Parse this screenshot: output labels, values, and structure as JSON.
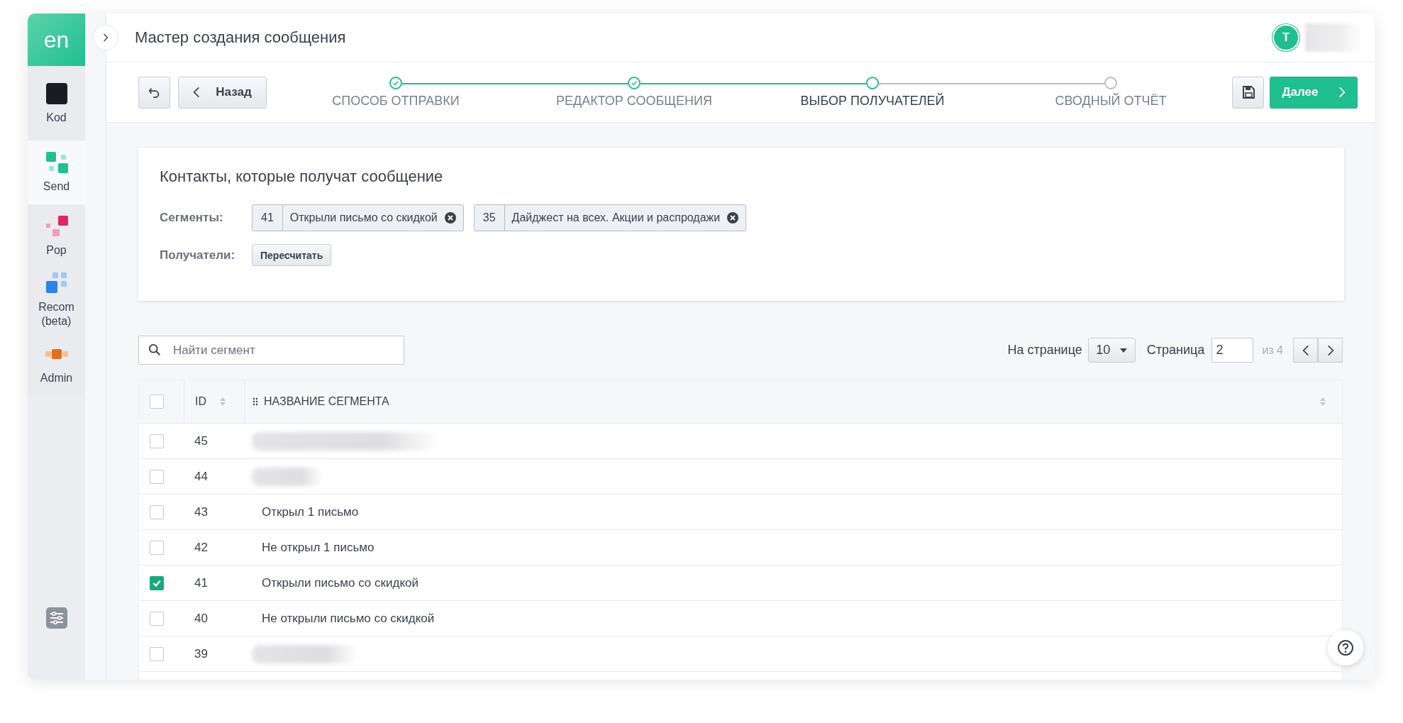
{
  "logo": "en",
  "sidebar": {
    "items": [
      {
        "label": "Kod",
        "kind": "kod",
        "selected": false
      },
      {
        "label": "Send",
        "kind": "send",
        "selected": true
      },
      {
        "label": "Pop",
        "kind": "pop",
        "selected": false
      },
      {
        "label": "Recom (beta)",
        "kind": "recom",
        "selected": false
      },
      {
        "label": "Admin",
        "kind": "admin",
        "selected": false
      }
    ]
  },
  "header": {
    "title": "Мастер создания сообщения",
    "user_initial": "T"
  },
  "toolbar": {
    "back_button": "Назад",
    "next_button": "Далее"
  },
  "steps": [
    {
      "label": "СПОСОБ ОТПРАВКИ",
      "done": true,
      "selected": false
    },
    {
      "label": "РЕДАКТОР СООБЩЕНИЯ",
      "done": true,
      "selected": false
    },
    {
      "label": "ВЫБОР ПОЛУЧАТЕЛЕЙ",
      "done": false,
      "selected": true
    },
    {
      "label": "СВОДНЫЙ ОТЧЁТ",
      "done": false,
      "selected": false
    }
  ],
  "recipients_card": {
    "title": "Контакты, которые получат сообщение",
    "segments_label": "Сегменты:",
    "segments": [
      {
        "id": "41",
        "name": "Открыли письмо со скидкой"
      },
      {
        "id": "35",
        "name": "Дайджест на всех. Акции и распродажи"
      }
    ],
    "recipients_label": "Получатели:",
    "recount_button": "Пересчитать"
  },
  "search": {
    "placeholder": "Найти сегмент"
  },
  "pagination": {
    "per_page_label": "На странице",
    "per_page": "10",
    "page_label": "Страница",
    "page": "2",
    "total": "из 4"
  },
  "table": {
    "columns": [
      "ID",
      "НАЗВАНИЕ СЕГМЕНТА"
    ],
    "select_all_checked": false,
    "rows": [
      {
        "id": "45",
        "kind": "redacted",
        "checked": false
      },
      {
        "id": "44",
        "kind": "redacted",
        "checked": false
      },
      {
        "id": "43",
        "kind": "text",
        "name": "Открыл 1 письмо",
        "checked": false
      },
      {
        "id": "42",
        "kind": "text",
        "name": "Не открыл 1 письмо",
        "checked": false
      },
      {
        "id": "41",
        "kind": "text",
        "name": "Открыли письмо со скидкой",
        "checked": true
      },
      {
        "id": "40",
        "kind": "text",
        "name": "Не открыли письмо со скидкой",
        "checked": false
      },
      {
        "id": "39",
        "kind": "redacted",
        "checked": false
      }
    ]
  }
}
